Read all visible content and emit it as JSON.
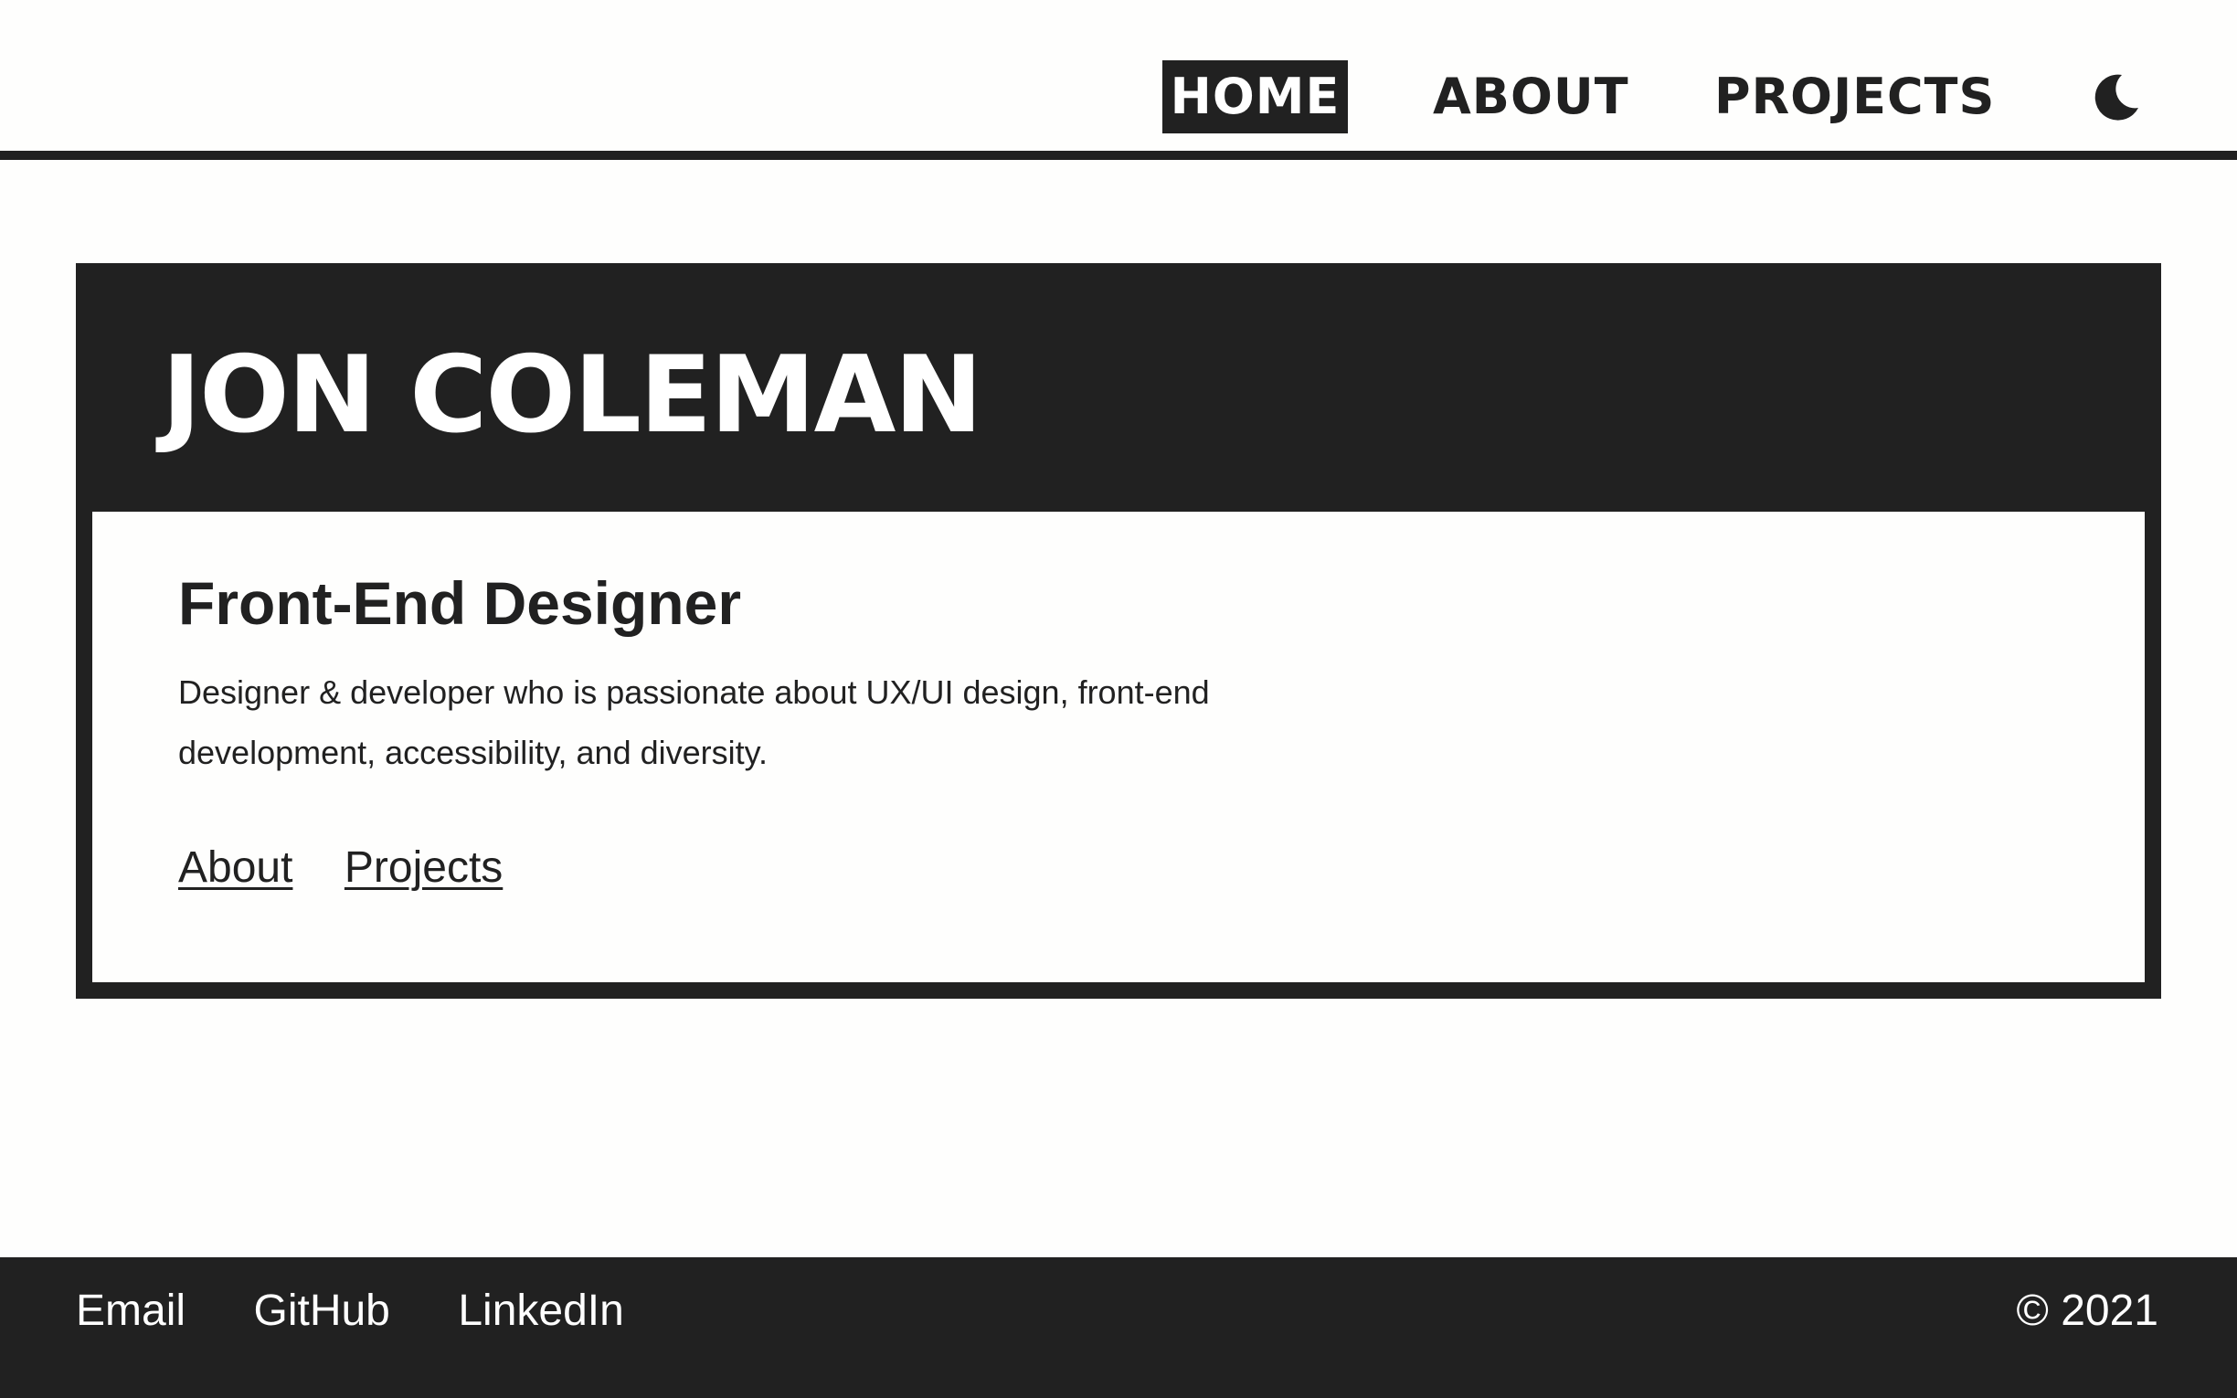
{
  "nav": {
    "items": [
      {
        "label": "HOME",
        "active": true
      },
      {
        "label": "ABOUT",
        "active": false
      },
      {
        "label": "PROJECTS",
        "active": false
      }
    ],
    "theme_toggle_icon": "moon-icon"
  },
  "hero": {
    "name": "JON COLEMAN",
    "role": "Front-End Designer",
    "bio": "Designer & developer who is passionate about UX/UI design, front-end development, accessibility, and diversity.",
    "links": [
      "About",
      "Projects"
    ]
  },
  "footer": {
    "links": [
      "Email",
      "GitHub",
      "LinkedIn"
    ],
    "copyright": "© 2021"
  },
  "colors": {
    "dark": "#212121",
    "light": "#fefefd"
  }
}
